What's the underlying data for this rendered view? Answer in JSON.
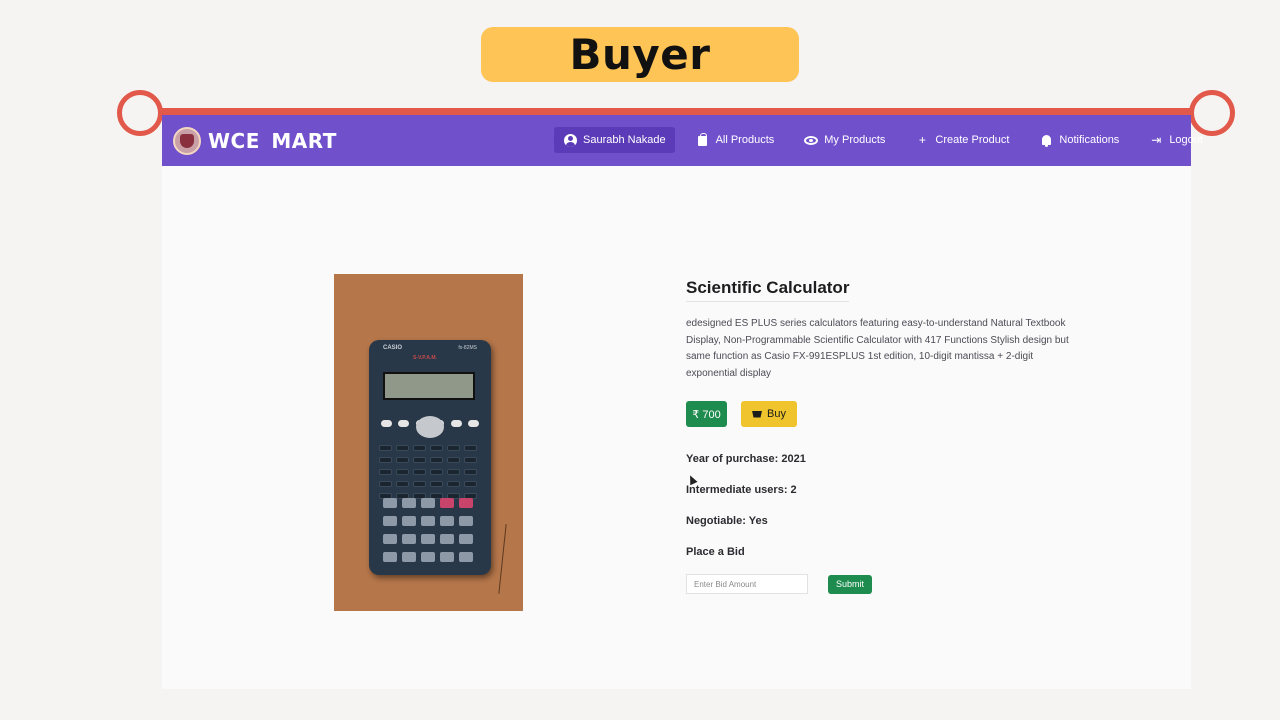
{
  "banner": {
    "label": "Buyer"
  },
  "app": {
    "brand": "WCE MART"
  },
  "nav": {
    "items": [
      {
        "label": "Saurabh Nakade",
        "icon": "user-icon"
      },
      {
        "label": "All Products",
        "icon": "bag-icon"
      },
      {
        "label": "My Products",
        "icon": "eye-icon"
      },
      {
        "label": "Create Product",
        "icon": "plus-icon"
      },
      {
        "label": "Notifications",
        "icon": "bell-icon"
      },
      {
        "label": "Logout",
        "icon": "logout-icon"
      }
    ]
  },
  "product": {
    "title": "Scientific Calculator",
    "description": "edesigned ES PLUS series calculators featuring easy-to-understand Natural Textbook Display, Non-Programmable Scientific Calculator with 417 Functions Stylish design but same function as Casio FX-991ESPLUS 1st edition, 10-digit mantissa + 2-digit exponential display",
    "price": "₹ 700",
    "buy_label": "Buy",
    "year_of_purchase": "Year of purchase: 2021",
    "intermediate_users": "Intermediate users: 2",
    "negotiable": "Negotiable: Yes",
    "image": {
      "brand_text": "CASIO",
      "model_text": "fx-82MS",
      "sub_text": "S-V.P.A.M."
    }
  },
  "bid": {
    "heading": "Place a Bid",
    "placeholder": "Enter Bid Amount",
    "submit_label": "Submit"
  },
  "colors": {
    "navbar": "#7150cc",
    "banner": "#fec456",
    "bracket": "#e2584a",
    "price_green": "#1e8c4f",
    "buy_yellow": "#f0c42c"
  }
}
